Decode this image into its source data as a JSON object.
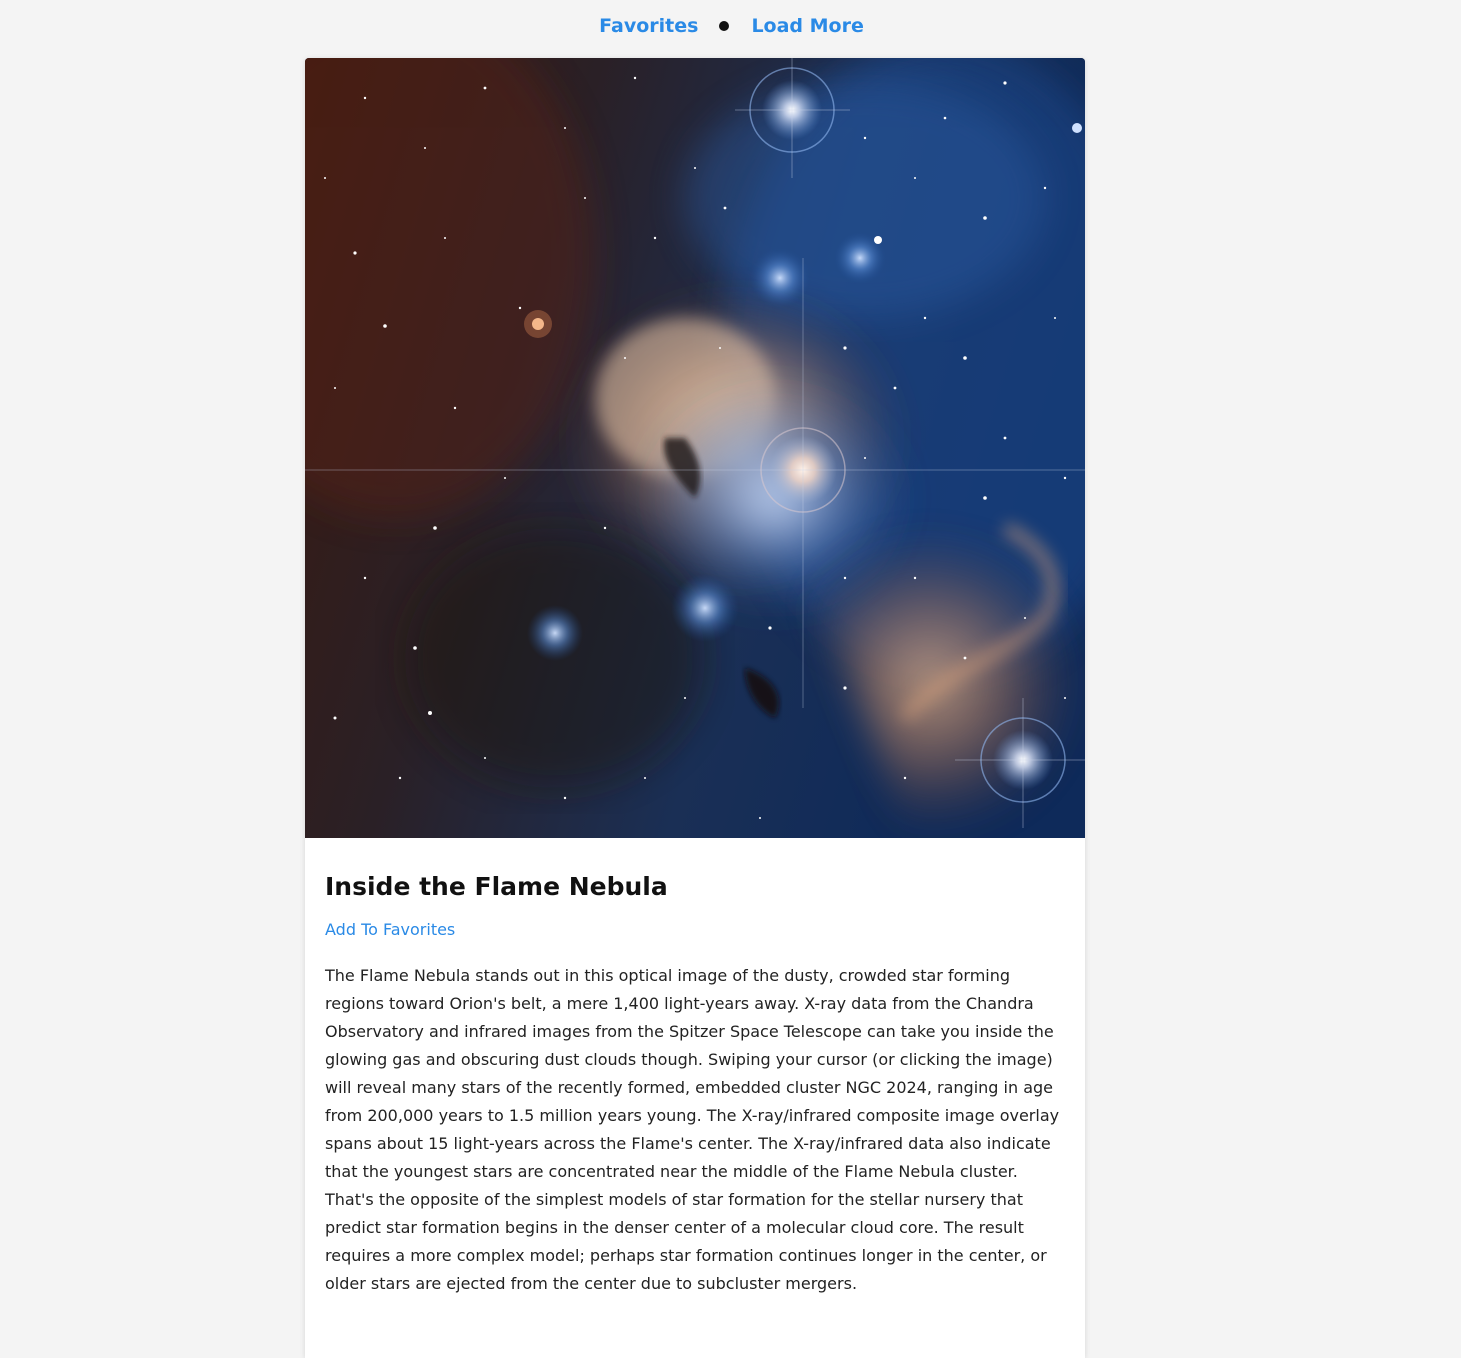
{
  "nav": {
    "favorites_label": "Favorites",
    "load_more_label": "Load More"
  },
  "article": {
    "title": "Inside the Flame Nebula",
    "add_favorites_label": "Add To Favorites",
    "image_alt": "Flame Nebula optical image",
    "description": "The Flame Nebula stands out in this optical image of the dusty, crowded star forming regions toward Orion's belt, a mere 1,400 light-years away. X-ray data from the Chandra Observatory and infrared images from the Spitzer Space Telescope can take you inside the glowing gas and obscuring dust clouds though. Swiping your cursor (or clicking the image) will reveal many stars of the recently formed, embedded cluster NGC 2024, ranging in age from 200,000 years to 1.5 million years young. The X-ray/infrared composite image overlay spans about 15 light-years across the Flame's center. The X-ray/infrared data also indicate that the youngest stars are concentrated near the middle of the Flame Nebula cluster. That's the opposite of the simplest models of star formation for the stellar nursery that predict star formation begins in the denser center of a molecular cloud core. The result requires a more complex model; perhaps star formation continues longer in the center, or older stars are ejected from the center due to subcluster mergers."
  },
  "colors": {
    "link": "#2a8ae6",
    "page_bg": "#f4f4f4",
    "card_bg": "#ffffff"
  }
}
